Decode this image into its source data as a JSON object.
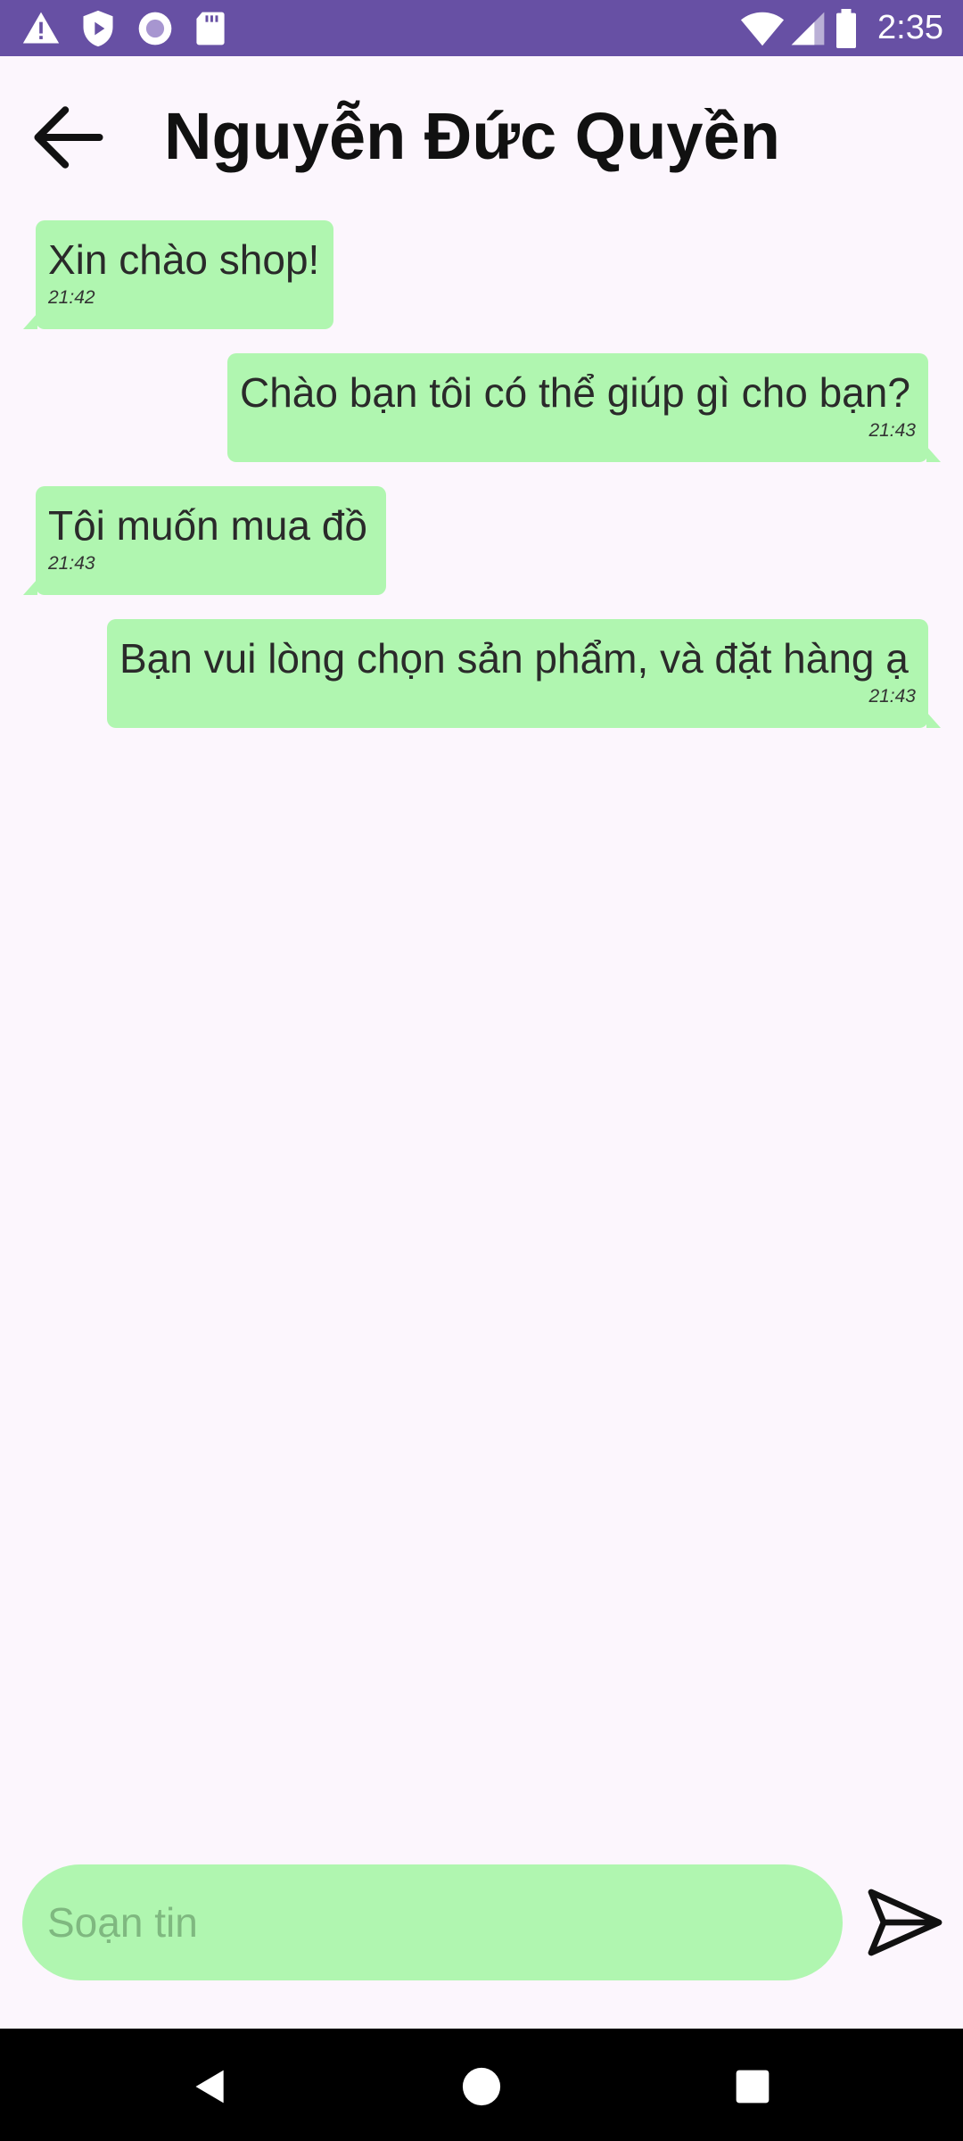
{
  "status_bar": {
    "time": "2:35",
    "left_icons": [
      "warning-icon",
      "shield-play-icon",
      "circle-record-icon",
      "sd-card-icon"
    ],
    "right_icons": [
      "wifi-icon",
      "signal-icon",
      "battery-icon"
    ]
  },
  "header": {
    "title": "Nguyễn Đức Quyền",
    "back_icon": "arrow-left-icon"
  },
  "messages": [
    {
      "side": "left",
      "text": "Xin chào shop!",
      "time": "21:42"
    },
    {
      "side": "right",
      "text": "Chào bạn tôi có thể giúp gì cho bạn?",
      "time": "21:43"
    },
    {
      "side": "left",
      "text": "Tôi muốn mua đồ",
      "time": "21:43"
    },
    {
      "side": "right",
      "text": "Bạn vui lòng chọn sản phẩm, và đặt hàng ạ",
      "time": "21:43"
    }
  ],
  "composer": {
    "placeholder": "Soạn tin",
    "value": "",
    "send_icon": "send-icon"
  },
  "nav_bar": {
    "icons": [
      "back-triangle-icon",
      "home-circle-icon",
      "recents-square-icon"
    ]
  },
  "colors": {
    "status_bar": "#6750a4",
    "background": "#fcf6fd",
    "bubble": "#b0f6b0",
    "nav_bar": "#000000"
  }
}
